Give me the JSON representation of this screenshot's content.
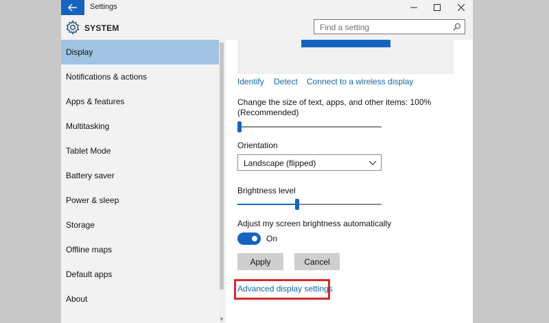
{
  "window": {
    "title": "Settings"
  },
  "header": {
    "section": "SYSTEM",
    "search_placeholder": "Find a setting"
  },
  "sidebar": {
    "items": [
      {
        "label": "Display"
      },
      {
        "label": "Notifications & actions"
      },
      {
        "label": "Apps & features"
      },
      {
        "label": "Multitasking"
      },
      {
        "label": "Tablet Mode"
      },
      {
        "label": "Battery saver"
      },
      {
        "label": "Power & sleep"
      },
      {
        "label": "Storage"
      },
      {
        "label": "Offline maps"
      },
      {
        "label": "Default apps"
      },
      {
        "label": "About"
      }
    ],
    "active": "Display"
  },
  "display": {
    "links": {
      "identify": "Identify",
      "detect": "Detect",
      "wireless": "Connect to a wireless display"
    },
    "scale": {
      "label_line1": "Change the size of text, apps, and other items: 100%",
      "label_line2": "(Recommended)",
      "level": 0
    },
    "orientation": {
      "label": "Orientation",
      "value": "Landscape (flipped)"
    },
    "brightness": {
      "label": "Brightness level",
      "level": 0.41
    },
    "auto_brightness": {
      "label": "Adjust my screen brightness automatically",
      "state": "On"
    },
    "buttons": {
      "apply": "Apply",
      "cancel": "Cancel"
    },
    "advanced_link": "Advanced display settings"
  },
  "colors": {
    "accent": "#1565c0",
    "sidebar_active": "#9fc3e1",
    "highlight_box": "#d42a2a",
    "link": "#1565a5"
  },
  "icons": [
    "back-arrow-icon",
    "minimize-icon",
    "maximize-icon",
    "close-icon",
    "gear-icon",
    "search-icon",
    "chevron-down-icon"
  ]
}
